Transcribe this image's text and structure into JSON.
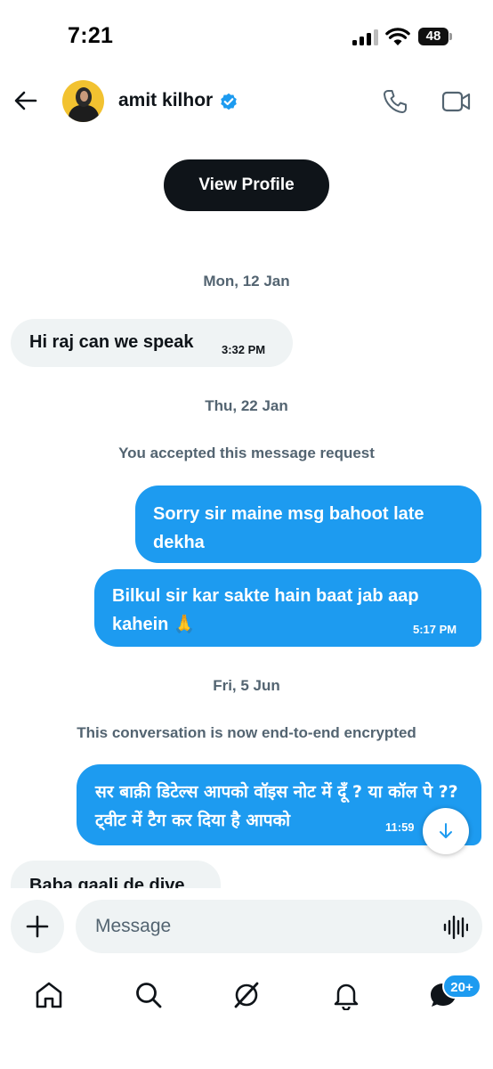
{
  "status_bar": {
    "time": "7:21",
    "battery": "48"
  },
  "header": {
    "contact_name": "amit kilhor",
    "verified": true
  },
  "conversation": {
    "view_profile_label": "View Profile",
    "dates": {
      "d1": "Mon, 12 Jan",
      "d2": "Thu, 22 Jan",
      "d3": "Fri, 5 Jun"
    },
    "system": {
      "accepted": "You accepted this message request",
      "encrypted": "This conversation is now end-to-end encrypted"
    },
    "messages": [
      {
        "direction": "in",
        "text": "Hi raj can we speak",
        "time": "3:32 PM"
      },
      {
        "direction": "out",
        "text": "Sorry sir maine msg bahoot late dekha",
        "time": ""
      },
      {
        "direction": "out",
        "text": "Bilkul sir kar sakte hain baat jab aap kahein 🙏",
        "time": "5:17 PM"
      },
      {
        "direction": "out",
        "text": "सर बाक़ी डिटेल्स आपको वॉइस नोट में दूँ ? या कॉल पे ?? ट्वीट में टैग कर दिया है आपको",
        "time": "11:59"
      },
      {
        "direction": "in",
        "text": "Baba gaali de dive",
        "time": ""
      }
    ]
  },
  "composer": {
    "placeholder": "Message"
  },
  "nav": {
    "items": [
      "home",
      "search",
      "grok",
      "notifications",
      "messages"
    ],
    "messages_badge": "20+"
  },
  "colors": {
    "accent": "#1d9bf0",
    "bubble_in": "#eff3f4",
    "text_primary": "#0f1419",
    "text_secondary": "#536471"
  }
}
